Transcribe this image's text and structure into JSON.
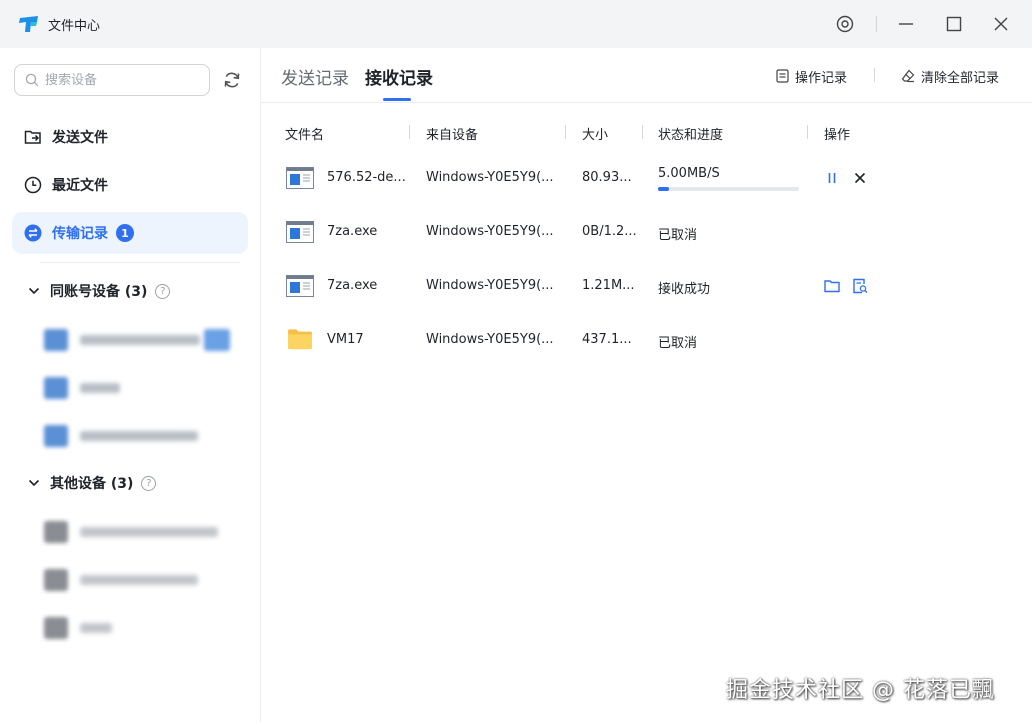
{
  "window": {
    "title": "文件中心",
    "controls": [
      "settings-icon",
      "minimize-icon",
      "maximize-icon",
      "close-icon"
    ]
  },
  "sidebar": {
    "search": {
      "placeholder": "搜索设备",
      "value": ""
    },
    "nav": [
      {
        "label": "发送文件",
        "icon": "send-file-icon",
        "active": false
      },
      {
        "label": "最近文件",
        "icon": "clock-icon",
        "active": false
      },
      {
        "label": "传输记录",
        "icon": "transfer-icon",
        "active": true,
        "badge": "1"
      }
    ],
    "groups": [
      {
        "label": "同账号设备 (3)",
        "help": "?",
        "expanded": true
      },
      {
        "label": "其他设备 (3)",
        "help": "?",
        "expanded": true
      }
    ]
  },
  "main": {
    "tabs": [
      {
        "label": "发送记录",
        "active": false
      },
      {
        "label": "接收记录",
        "active": true
      }
    ],
    "toolbar": {
      "log_label": "操作记录",
      "clear_label": "清除全部记录"
    },
    "columns": [
      "文件名",
      "来自设备",
      "大小",
      "状态和进度",
      "操作"
    ],
    "rows": [
      {
        "name": "576.52-de...",
        "device": "Windows-Y0E5Y9(...",
        "size": "80.93...",
        "status": "5.00MB/S",
        "progress": 0.08,
        "icon": "exe-file-icon",
        "actions": [
          "pause-icon",
          "cancel-icon"
        ]
      },
      {
        "name": "7za.exe",
        "device": "Windows-Y0E5Y9(...",
        "size": "0B/1.2...",
        "status": "已取消",
        "icon": "exe-file-icon",
        "actions": []
      },
      {
        "name": "7za.exe",
        "device": "Windows-Y0E5Y9(...",
        "size": "1.21M...",
        "status": "接收成功",
        "icon": "exe-file-icon",
        "actions": [
          "open-folder-icon",
          "view-file-icon"
        ]
      },
      {
        "name": "VM17",
        "device": "Windows-Y0E5Y9(...",
        "size": "437.1...",
        "status": "已取消",
        "icon": "folder-icon",
        "actions": []
      }
    ]
  },
  "watermark": "掘金技术社区 @ 花落已飄",
  "colors": {
    "accent": "#2f6ff0",
    "active_nav_bg": "#eef4fd",
    "titlebar_bg": "#f3f4f6"
  }
}
